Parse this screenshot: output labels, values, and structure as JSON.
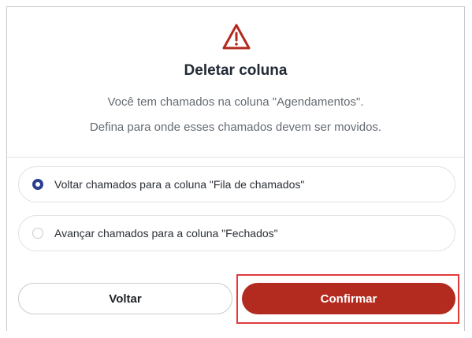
{
  "dialog": {
    "icon": "warning-triangle-icon",
    "title": "Deletar coluna",
    "description_line1": "Você tem chamados na coluna \"Agendamentos\".",
    "description_line2": "Defina para onde esses chamados devem ser movidos."
  },
  "options": [
    {
      "label": "Voltar chamados para a coluna \"Fila de chamados\"",
      "selected": true
    },
    {
      "label": "Avançar chamados para a coluna \"Fechados\"",
      "selected": false
    }
  ],
  "buttons": {
    "back_label": "Voltar",
    "confirm_label": "Confirmar"
  },
  "colors": {
    "accent_danger": "#b32a1f",
    "radio_selected": "#2d3f8f",
    "highlight_border": "#e23a3a",
    "title_text": "#222a35"
  }
}
